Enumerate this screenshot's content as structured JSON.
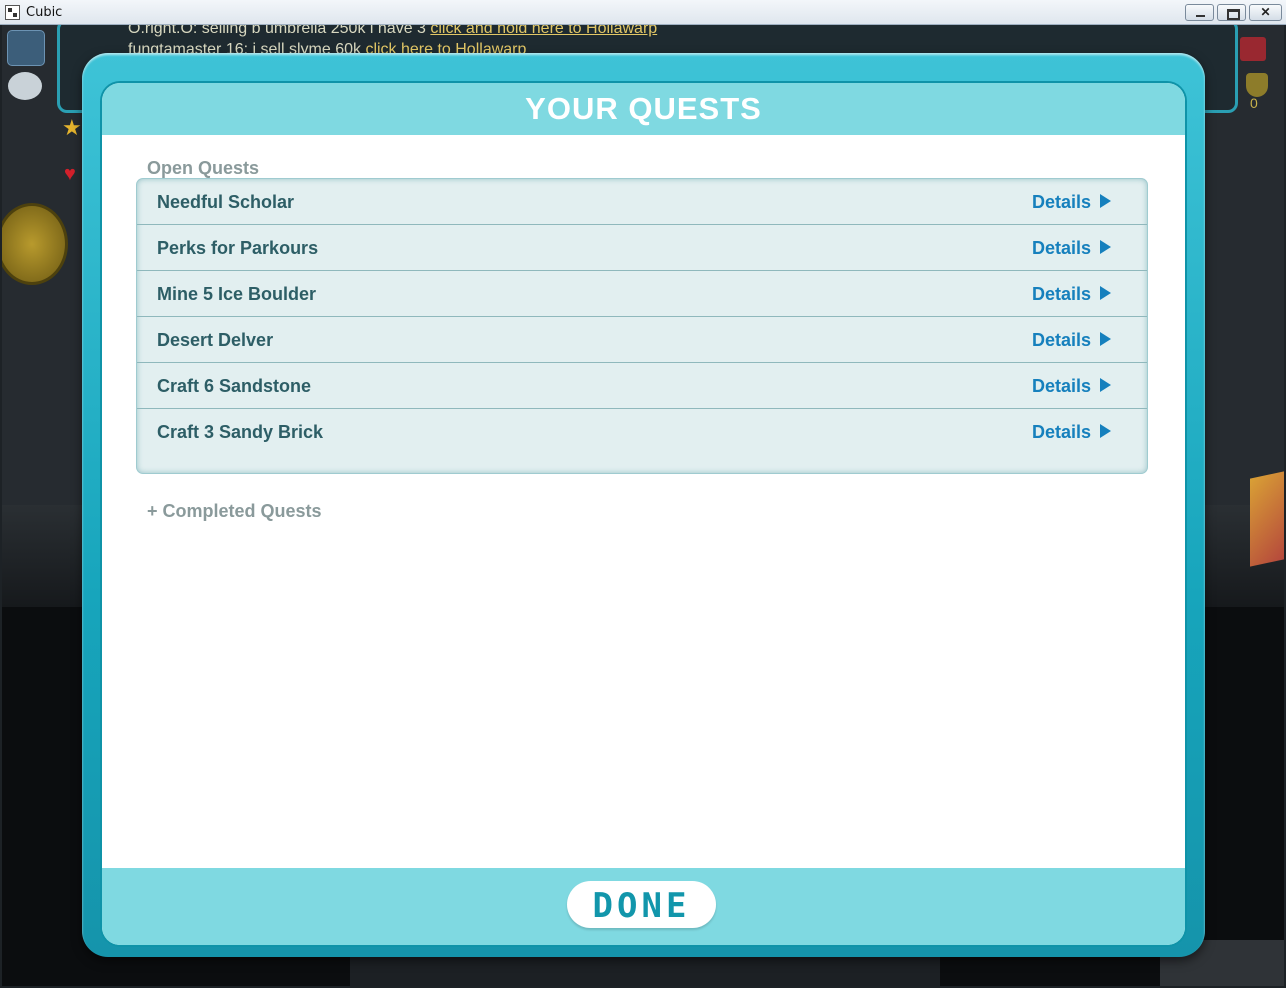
{
  "window": {
    "title": "Cubic"
  },
  "background": {
    "chat": [
      {
        "text": "O.right.O: selling b umbrella 250k i have 3 ",
        "link": "click and hold here to Hollawarp"
      },
      {
        "text": "fungtamaster 16: i sell slyme 60k ",
        "link": "click here to Hollawarp"
      }
    ],
    "shield_count": "0"
  },
  "dialog": {
    "title": "YOUR QUESTS",
    "open_label": "Open Quests",
    "completed_label": "+ Completed Quests",
    "details_label": "Details",
    "done_label": "DONE",
    "quests": [
      {
        "name": "Needful Scholar"
      },
      {
        "name": "Perks for Parkours"
      },
      {
        "name": "Mine 5 Ice Boulder"
      },
      {
        "name": "Desert Delver"
      },
      {
        "name": "Craft 6 Sandstone"
      },
      {
        "name": "Craft 3 Sandy Brick"
      }
    ]
  },
  "colors": {
    "frame": "#17a5bc",
    "header": "#7fd9e1",
    "link": "#1680bd",
    "quest_text": "#2d5e66"
  }
}
